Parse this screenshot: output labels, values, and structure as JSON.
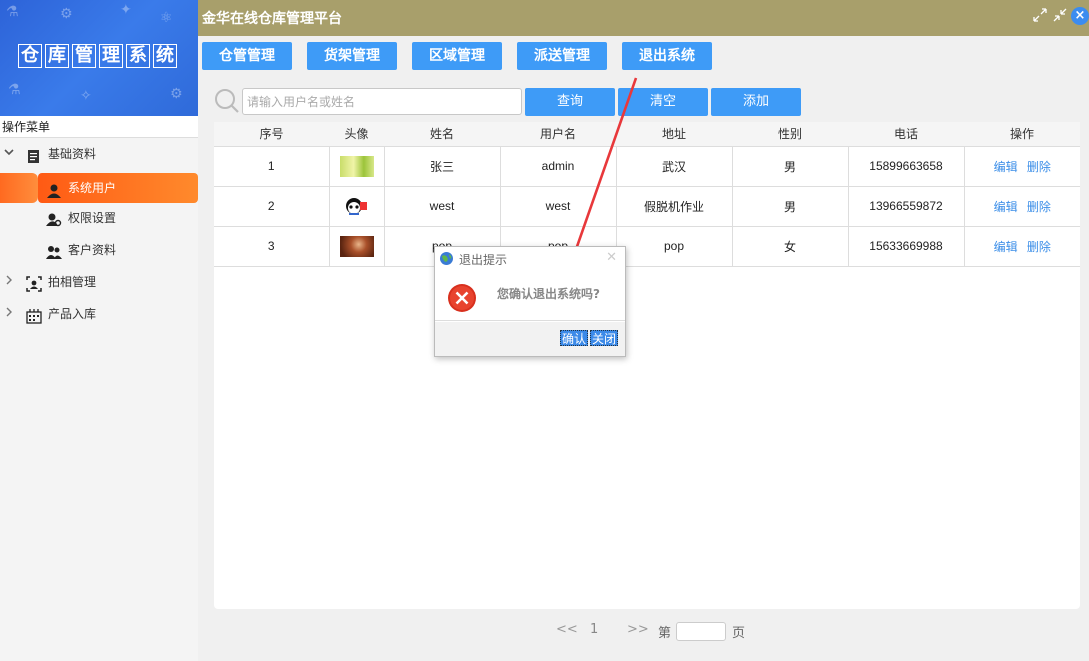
{
  "app": {
    "logo_chars": [
      "仓",
      "库",
      "管",
      "理",
      "系",
      "统"
    ],
    "title": "金华在线仓库管理平台"
  },
  "sidebar": {
    "header": "操作菜单",
    "groups": [
      {
        "label": "基础资料",
        "expanded": true,
        "icon": "document-icon"
      },
      {
        "label": "拍相管理",
        "expanded": false,
        "icon": "camera-frame-icon"
      },
      {
        "label": "产品入库",
        "expanded": false,
        "icon": "inventory-icon"
      }
    ],
    "items": [
      {
        "label": "系统用户",
        "icon": "user-icon",
        "active": true
      },
      {
        "label": "权限设置",
        "icon": "user-key-icon",
        "active": false
      },
      {
        "label": "客户资料",
        "icon": "users-icon",
        "active": false
      }
    ]
  },
  "nav": {
    "buttons": [
      "仓管管理",
      "货架管理",
      "区域管理",
      "派送管理",
      "退出系统"
    ]
  },
  "search": {
    "placeholder": "请输入用户名或姓名",
    "value": "",
    "query_label": "查询",
    "clear_label": "清空",
    "add_label": "添加"
  },
  "table": {
    "headers": [
      "序号",
      "头像",
      "姓名",
      "用户名",
      "地址",
      "性别",
      "电话",
      "操作"
    ],
    "rows": [
      {
        "no": "1",
        "name": "张三",
        "username": "admin",
        "address": "武汉",
        "gender": "男",
        "phone": "15899663658",
        "avatar": "green-avatar"
      },
      {
        "no": "2",
        "name": "west",
        "username": "west",
        "address": "假脱机作业",
        "gender": "男",
        "phone": "13966559872",
        "avatar": "panda-avatar"
      },
      {
        "no": "3",
        "name": "pop",
        "username": "pop",
        "address": "pop",
        "gender": "女",
        "phone": "15633669988",
        "avatar": "brown-avatar"
      }
    ],
    "edit_label": "编辑",
    "delete_label": "删除"
  },
  "pager": {
    "prev": "<<",
    "page": "1",
    "next": ">>",
    "prefix": "第",
    "suffix": "页",
    "input_value": ""
  },
  "dialog": {
    "title": "退出提示",
    "message": "您确认退出系统吗?",
    "confirm_label": "确认",
    "close_label": "关闭"
  },
  "colors": {
    "topbar": "#a89f6b",
    "button": "#3e9bf7",
    "active": "#ff6a20",
    "link": "#3b8ee8",
    "annotation_arrow": "#e8383b"
  }
}
